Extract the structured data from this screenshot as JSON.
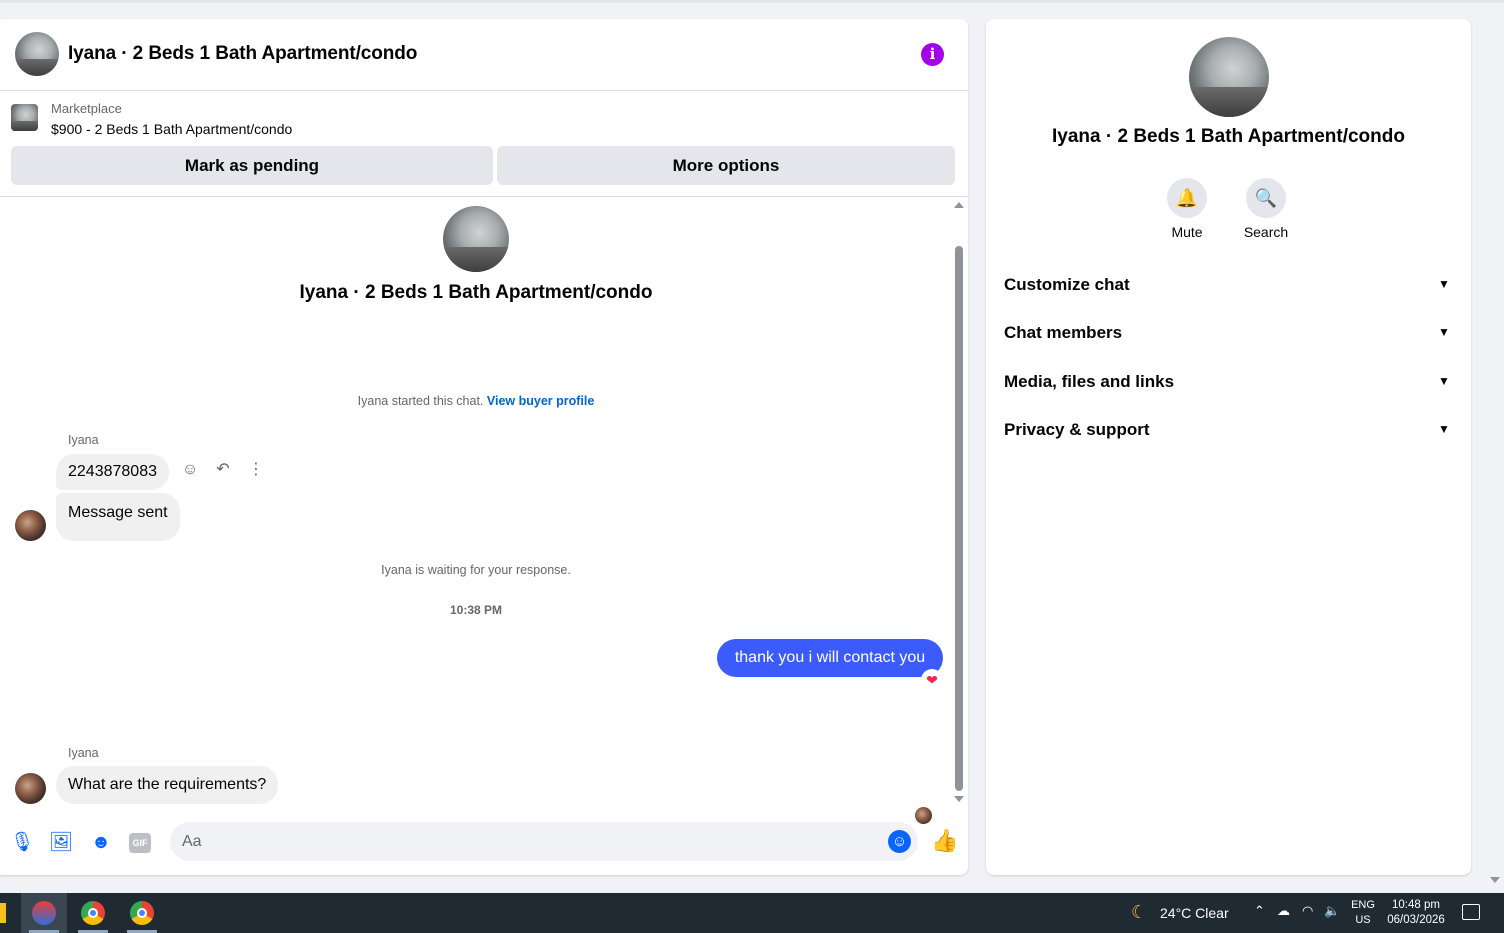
{
  "chat": {
    "title": "Iyana · 2 Beds 1 Bath Apartment/condo",
    "marketplace": {
      "label": "Marketplace",
      "listing": "$900 - 2 Beds 1 Bath Apartment/condo",
      "mark_pending_label": "Mark as pending",
      "more_options_label": "More options"
    },
    "thread": {
      "title": "Iyana · 2 Beds 1 Bath Apartment/condo",
      "started_text": "Iyana started this chat.",
      "buyer_profile_link": "View buyer profile",
      "waiting_text": "Iyana is waiting for your response.",
      "timestamp": "10:38 PM",
      "messages": [
        {
          "sender": "Iyana",
          "text": "2243878083",
          "direction": "in"
        },
        {
          "sender": "",
          "text": "Message sent",
          "direction": "in"
        },
        {
          "sender": "",
          "text": "thank you i will contact you",
          "direction": "out",
          "reaction": "heart"
        },
        {
          "sender": "Iyana",
          "text": "What are the requirements?",
          "direction": "in"
        }
      ]
    },
    "composer": {
      "placeholder": "Aa",
      "value": "",
      "gif_label": "GIF"
    },
    "colors": {
      "accent": "#0866ff",
      "outgoing_bubble": "#3b5bfd",
      "info_icon": "#a400e6"
    }
  },
  "info_panel": {
    "title": "Iyana · 2 Beds 1 Bath Apartment/condo",
    "actions": [
      {
        "label": "Mute",
        "icon": "bell-icon"
      },
      {
        "label": "Search",
        "icon": "search-icon"
      }
    ],
    "sections": [
      {
        "label": "Customize chat"
      },
      {
        "label": "Chat members"
      },
      {
        "label": "Media, files and links"
      },
      {
        "label": "Privacy & support"
      }
    ]
  },
  "taskbar": {
    "weather": "24°C Clear",
    "lang_top": "ENG",
    "lang_bottom": "US",
    "time": "10:48 pm",
    "date": "06/03/2026"
  }
}
